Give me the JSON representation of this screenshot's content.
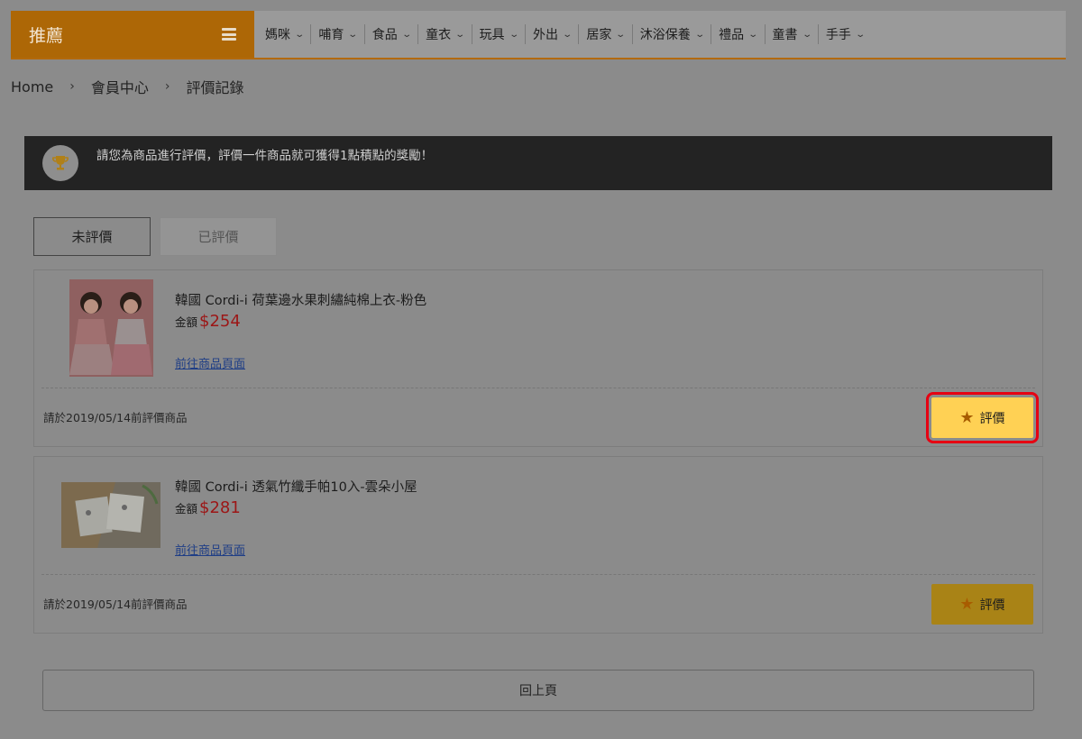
{
  "nav": {
    "brand": "推薦",
    "menu_icon": "hamburger-icon",
    "items": [
      {
        "label": "媽咪"
      },
      {
        "label": "哺育"
      },
      {
        "label": "食品"
      },
      {
        "label": "童衣"
      },
      {
        "label": "玩具"
      },
      {
        "label": "外出"
      },
      {
        "label": "居家"
      },
      {
        "label": "沐浴保養"
      },
      {
        "label": "禮品"
      },
      {
        "label": "童書"
      },
      {
        "label": "手手"
      }
    ],
    "chevron": "⌄"
  },
  "breadcrumb": {
    "items": [
      "Home",
      "會員中心",
      "評價記錄"
    ],
    "separator": "›"
  },
  "banner": {
    "icon": "trophy-icon",
    "text": "請您為商品進行評價，評價一件商品就可獲得1點積點的獎勵！"
  },
  "tabs": [
    {
      "label": "未評價",
      "active": true
    },
    {
      "label": "已評價",
      "active": false
    }
  ],
  "products": [
    {
      "title": "韓國 Cordi-i 荷葉邊水果刺繡純棉上衣-粉色",
      "price_label": "金額",
      "price": "$254",
      "link": "前往商品頁面",
      "deadline": "請於2019/05/14前評價商品",
      "button": "評價"
    },
    {
      "title": "韓國 Cordi-i 透氣竹纖手帕10入-雲朵小屋",
      "price_label": "金額",
      "price": "$281",
      "link": "前往商品頁面",
      "deadline": "請於2019/05/14前評價商品",
      "button": "評價"
    }
  ],
  "footer": {
    "back_label": "回上頁"
  },
  "colors": {
    "brand": "#ad6706",
    "accent_button": "#ffd154",
    "price": "#9c1616",
    "highlight_border": "#e60012"
  }
}
